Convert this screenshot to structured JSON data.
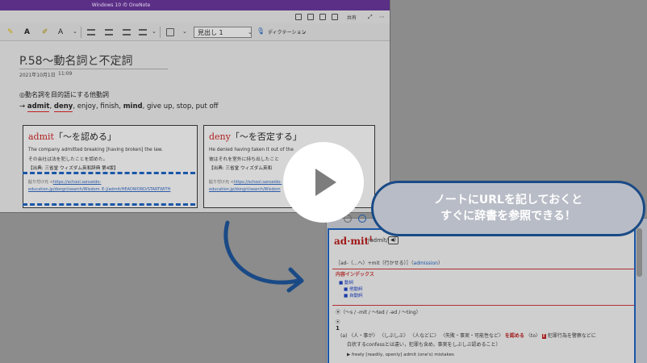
{
  "window": {
    "title": "Windows 10 の OneNote",
    "share_label": "共有",
    "ribbon": {
      "style_value": "見出し 1",
      "dictation_label": "ディクテーション"
    }
  },
  "page": {
    "title": "P.58～動名詞と不定詞",
    "date": "2021年10月1日",
    "time": "11:09",
    "heading": "◎動名詞を目的語にする他動詞",
    "verbs": {
      "prefix": "→",
      "v1": "admit",
      "v2": "deny",
      "rest": ", enjoy,  finish, ",
      "v3": "mind",
      "rest2": ", give up, stop, put off"
    },
    "cards": [
      {
        "headword": "admit",
        "meaning": "「～を認める」",
        "english": "The company admitted breaking [having broken] the law.",
        "japanese": "その会社は法を犯したことを認めた。",
        "source": "【出典: 三省堂 ウィズダム英和辞典 第4版】",
        "link_label": "貼り付け元  <",
        "link_line1": "https://school.sanseido-",
        "link_line2": "education.jp/dongri/search/Wisdom_E-J/admit/HEADWORD/STARTWITH"
      },
      {
        "headword": "deny",
        "meaning": "「～を否定する」",
        "english": "He denied having taken it out of the",
        "japanese": "彼はそれを室外に持ち出したこと",
        "source": "【出典: 三省堂 ウィズダム英和",
        "link_label": "貼り付け元  <",
        "link_line1": "https://school.sanseido-",
        "link_line2": "education.jp/dongri/search/Wisdom"
      }
    ]
  },
  "callout": {
    "line1": "ノートにURLを記しておくと",
    "line2": "すぐに辞書を参照できる！"
  },
  "dictionary": {
    "headword": "ad·mit",
    "superscript": "1",
    "pron": "/ədmít/",
    "speaker": "◀)",
    "cross_ref": "［ad-（…へ）+mit（行かせる）］（",
    "cross_ref_link": "admission",
    "cross_ref_end": "）",
    "index_title": "内容インデックス",
    "index_items": [
      "■ 動詞",
      "■ 他動詞",
      "■ 自動詞"
    ],
    "grammar": "⦿（～s / -mít / ～ted / -əd / ～ting）",
    "mark": "⦿",
    "sense_num": "1",
    "sense_a": "(a)  〈人・事が〉  〈しぶしぶ〉  〈人などに〉  〈失敗・事実・可能性など〉",
    "sense_red": "を認める",
    "sense_a2": "〈to〉",
    "sense_badge": "E",
    "sense_tail": "犯罪行為を警察などに",
    "sense_line2": "白状するconfessとは違い，犯罪も含め，事実をしぶしぶ認めること）",
    "example": "▶ freely [readily, openly] admit (one's) mistakes"
  }
}
